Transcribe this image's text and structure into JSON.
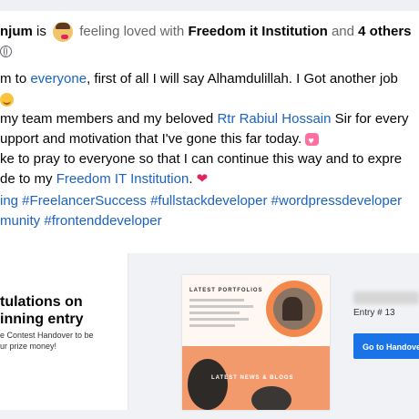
{
  "post": {
    "author_name": "njum",
    "is_text": "is",
    "feeling_text": "feeling loved with",
    "tagged_page": "Freedom it Institution",
    "and_text": "and",
    "others_text": "4 others",
    "privacy_icon": "globe-icon"
  },
  "body_lines": {
    "l1_a": "m to ",
    "l1_link": "everyone",
    "l1_b": ", first of all I will say Alhamdulillah. I Got another job",
    "l3_a": "my team members and my beloved ",
    "l3_link": "Rtr Rabiul Hossain",
    "l3_b": " Sir for every",
    "l4_a": "upport and motivation that I've gone this far today.",
    "l5_a": "ke to pray to everyone so that I can continue this way and to expre",
    "l6_a": "de to my ",
    "l6_link": "Freedom IT Institution",
    "l6_b": "."
  },
  "hashtags": {
    "line1": "ing #FreelancerSuccess #fullstackdeveloper #wordpressdeveloper",
    "line2": "munity #frontenddeveloper"
  },
  "card": {
    "title_line1": "tulations on",
    "title_line2": "inning entry",
    "desc_line1": "e Contest Handover to be",
    "desc_line2": "ur prize money!",
    "thumb_label": "LATEST PORTFOLIOS",
    "thumb_news": "LATEST NEWS & BLOGS",
    "entry_label": "Entry # 13",
    "button_label": "Go to Handover"
  },
  "colors": {
    "link": "#1a62c4",
    "button": "#1b73e8",
    "accent_orange": "#f3884d"
  }
}
